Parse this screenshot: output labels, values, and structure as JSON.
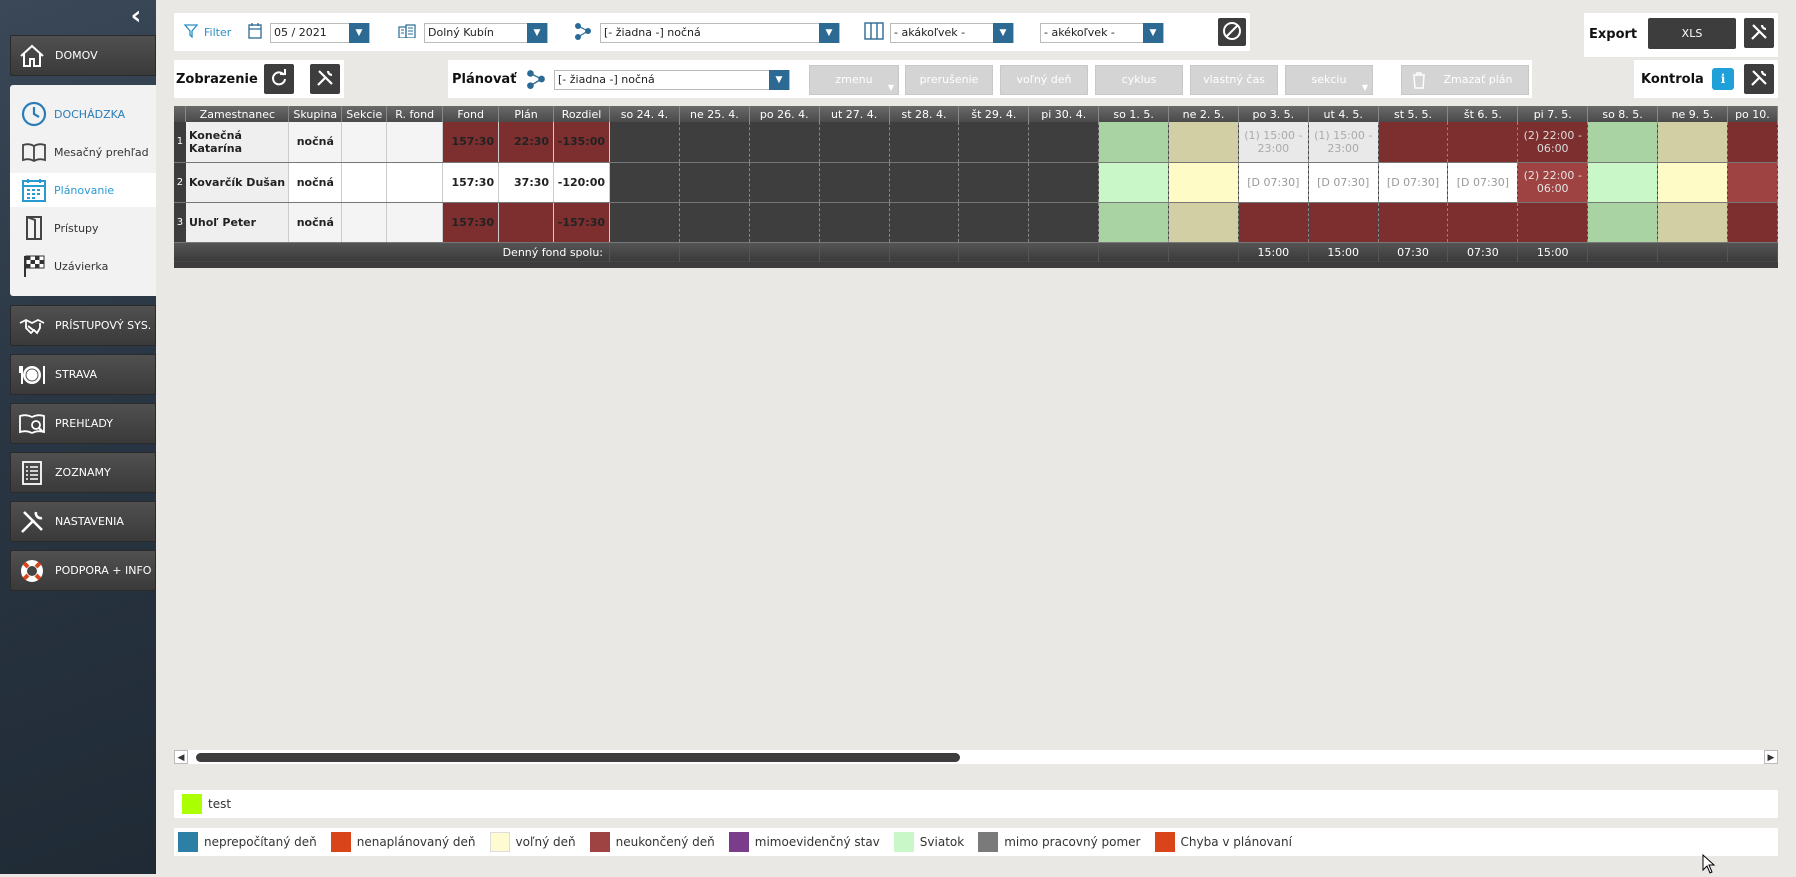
{
  "sidebar": {
    "collapse_icon": "chevron-left-icon",
    "items": [
      {
        "label": "DOMOV",
        "icon": "home-icon"
      },
      {
        "label": "PRÍSTUPOVÝ SYS.",
        "icon": "handshake-icon"
      },
      {
        "label": "STRAVA",
        "icon": "plate-icon"
      },
      {
        "label": "PREHĽADY",
        "icon": "book-search-icon"
      },
      {
        "label": "ZOZNAMY",
        "icon": "list-icon"
      },
      {
        "label": "NASTAVENIA",
        "icon": "tools-icon"
      },
      {
        "label": "PODPORA + INFO",
        "icon": "lifebuoy-icon"
      }
    ],
    "submenu": [
      {
        "label": "DOCHÁDZKA",
        "icon": "clock-icon"
      },
      {
        "label": "Mesačný prehľad",
        "icon": "open-book-icon"
      },
      {
        "label": "Plánovanie",
        "icon": "calendar-icon"
      },
      {
        "label": "Prístupy",
        "icon": "door-icon"
      },
      {
        "label": "Uzávierka",
        "icon": "checkered-flag-icon"
      }
    ]
  },
  "filterbar": {
    "filter_label": "Filter",
    "month": "05 / 2021",
    "location": "Dolný Kubín",
    "shift": "[- žiadna -] nočná",
    "columns": "- akákoľvek -",
    "other": "- akékoľvek -"
  },
  "export": {
    "label": "Export",
    "xls_label": "XLS"
  },
  "view": {
    "label": "Zobrazenie"
  },
  "plan": {
    "label": "Plánovať",
    "shift": "[- žiadna -] nočná",
    "buttons": {
      "zmenu": "zmenu",
      "prerusenie": "prerušenie",
      "volny_den": "voľný deň",
      "cyklus": "cyklus",
      "vlastny_cas": "vlastný čas",
      "sekciu": "sekciu",
      "zmazat_plan": "Zmazať plán"
    }
  },
  "kontrola": {
    "label": "Kontrola"
  },
  "table": {
    "headers": {
      "employee": "Zamestnanec",
      "group": "Skupina",
      "sections": "Sekcie",
      "r_fond": "R. fond",
      "fond": "Fond",
      "plan": "Plán",
      "diff": "Rozdiel"
    },
    "days": [
      "so 24. 4.",
      "ne 25. 4.",
      "po 26. 4.",
      "ut 27. 4.",
      "st 28. 4.",
      "št 29. 4.",
      "pi 30. 4.",
      "so 1. 5.",
      "ne 2. 5.",
      "po 3. 5.",
      "ut 4. 5.",
      "st 5. 5.",
      "št 6. 5.",
      "pi 7. 5.",
      "so 8. 5.",
      "ne 9. 5.",
      "po 10."
    ],
    "rows": [
      {
        "index": "1",
        "employee": "Konečná Katarína",
        "group": "nočná",
        "sections": "",
        "r_fond": "",
        "fond": "157:30",
        "plan": "22:30",
        "diff": "-135:00",
        "cells": [
          "",
          "",
          "",
          "",
          "",
          "",
          "",
          "",
          "",
          "(1) 15:00 - 23:00",
          "(1) 15:00 - 23:00",
          "",
          "",
          "(2) 22:00 - 06:00",
          "",
          "",
          ""
        ]
      },
      {
        "index": "2",
        "employee": "Kovarčík Dušan",
        "group": "nočná",
        "sections": "",
        "r_fond": "",
        "fond": "157:30",
        "plan": "37:30",
        "diff": "-120:00",
        "cells": [
          "",
          "",
          "",
          "",
          "",
          "",
          "",
          "",
          "",
          "[D 07:30]",
          "[D 07:30]",
          "[D 07:30]",
          "[D 07:30]",
          "(2) 22:00 - 06:00",
          "",
          "",
          ""
        ]
      },
      {
        "index": "3",
        "employee": "Uhoľ Peter",
        "group": "nočná",
        "sections": "",
        "r_fond": "",
        "fond": "157:30",
        "plan": "",
        "diff": "-157:30",
        "cells": [
          "",
          "",
          "",
          "",
          "",
          "",
          "",
          "",
          "",
          "",
          "",
          "",
          "",
          "",
          "",
          "",
          ""
        ]
      }
    ],
    "footer": {
      "label": "Denný fond spolu:",
      "values": [
        "",
        "",
        "",
        "",
        "",
        "",
        "",
        "",
        "",
        "15:00",
        "15:00",
        "07:30",
        "07:30",
        "15:00",
        "",
        "",
        ""
      ]
    }
  },
  "legend_groups": [
    {
      "label": "test",
      "color": "#aaff00"
    }
  ],
  "legend_states": [
    {
      "label": "neprepočítaný deň",
      "color": "#2e7fa5"
    },
    {
      "label": "nenaplánovaný deň",
      "color": "#d9441a"
    },
    {
      "label": "voľný deň",
      "color": "#fffbd0"
    },
    {
      "label": "neukončený deň",
      "color": "#9e4242"
    },
    {
      "label": "mimoevidenčný stav",
      "color": "#7a3d8c"
    },
    {
      "label": "Sviatok",
      "color": "#c9f7c8"
    },
    {
      "label": "mimo pracovný pomer",
      "color": "#7a7a7a"
    },
    {
      "label": "Chyba v plánovaní",
      "color": "#d9441a"
    }
  ]
}
